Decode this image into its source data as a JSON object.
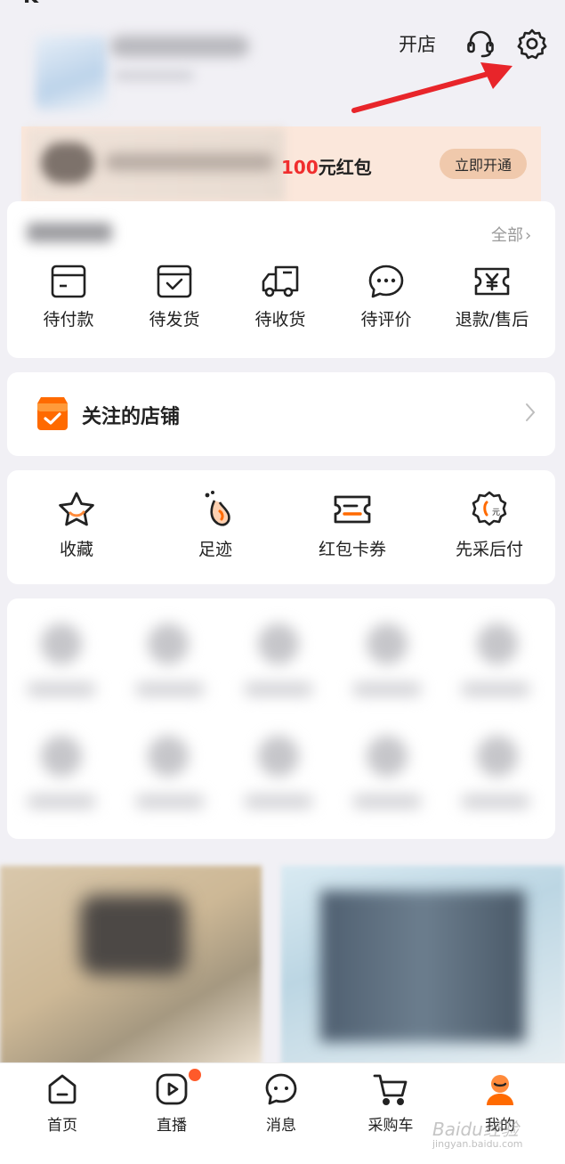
{
  "header": {
    "status_fragment": "K",
    "open_store": "开店",
    "icons": [
      "headset-icon",
      "gear-icon"
    ]
  },
  "annotation": {
    "arrow_color": "#e8252a"
  },
  "banner": {
    "amount": "100",
    "title_suffix": "元红包",
    "button": "立即开通"
  },
  "orders": {
    "all_label": "全部",
    "items": [
      {
        "label": "待付款",
        "icon": "wallet-icon"
      },
      {
        "label": "待发货",
        "icon": "package-check-icon"
      },
      {
        "label": "待收货",
        "icon": "truck-icon"
      },
      {
        "label": "待评价",
        "icon": "chat-bubble-icon"
      },
      {
        "label": "退款/售后",
        "icon": "refund-yuan-icon"
      }
    ]
  },
  "follow": {
    "label": "关注的店铺"
  },
  "tools": {
    "items": [
      {
        "label": "收藏",
        "icon": "star-icon"
      },
      {
        "label": "足迹",
        "icon": "footprint-icon"
      },
      {
        "label": "红包卡券",
        "icon": "coupon-icon"
      },
      {
        "label": "先采后付",
        "icon": "pay-later-icon"
      }
    ]
  },
  "tabbar": {
    "items": [
      {
        "label": "首页",
        "icon": "home-icon"
      },
      {
        "label": "直播",
        "icon": "live-play-icon"
      },
      {
        "label": "消息",
        "icon": "message-icon"
      },
      {
        "label": "采购车",
        "icon": "cart-icon"
      },
      {
        "label": "我的",
        "icon": "profile-icon"
      }
    ]
  },
  "watermark": {
    "brand": "Baidu经验",
    "url": "jingyan.baidu.com"
  },
  "colors": {
    "accent": "#ff6a00",
    "price_red": "#f02e2e",
    "banner_bg": "#fbe7db",
    "page_bg": "#f1f0f5"
  }
}
